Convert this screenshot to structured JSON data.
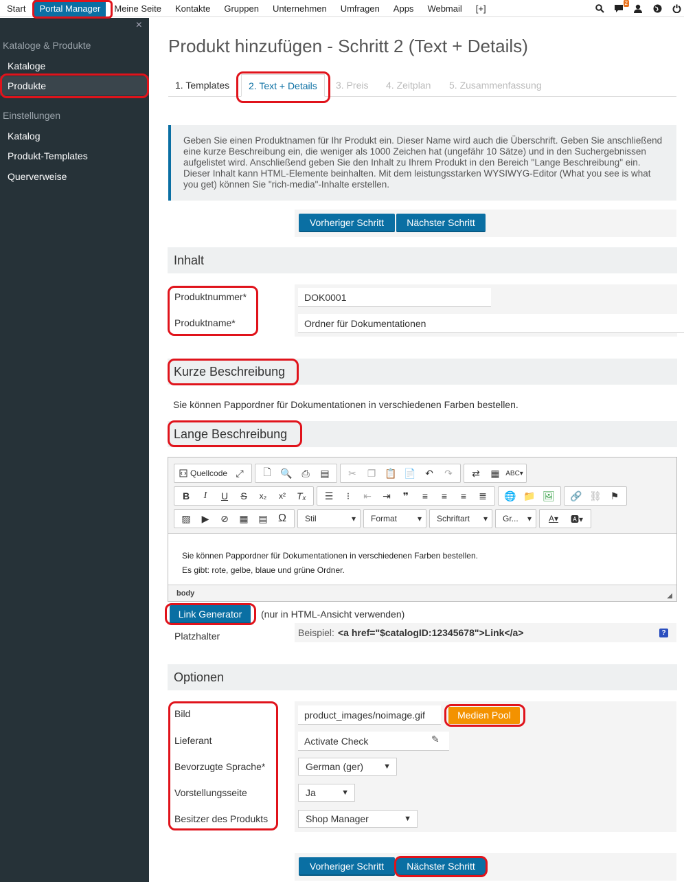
{
  "topnav": {
    "items": [
      "Start",
      "Portal Manager",
      "Meine Seite",
      "Kontakte",
      "Gruppen",
      "Unternehmen",
      "Umfragen",
      "Apps",
      "Webmail",
      "[+]"
    ],
    "notification_count": "2"
  },
  "sidebar": {
    "close": "×",
    "section1": "Kataloge & Produkte",
    "link_kataloge": "Kataloge",
    "link_produkte": "Produkte",
    "section2": "Einstellungen",
    "link_katalog": "Katalog",
    "link_templates": "Produkt-Templates",
    "link_querverweise": "Querverweise"
  },
  "page": {
    "title": "Produkt hinzufügen - Schritt 2 (Text + Details)",
    "tabs": [
      "1. Templates",
      "2. Text + Details",
      "3. Preis",
      "4. Zeitplan",
      "5. Zusammenfassung"
    ],
    "info": "Geben Sie einen Produktnamen für Ihr Produkt ein. Dieser Name wird auch die Überschrift. Geben Sie anschließend eine kurze Beschreibung ein, die weniger als 1000 Zeichen hat (ungefähr 10 Sätze) und in den Suchergebnissen aufgelistet wird. Anschließend geben Sie den Inhalt zu Ihrem Produkt in den Bereich \"Lange Beschreibung\" ein. Dieser Inhalt kann HTML-Elemente beinhalten. Mit dem leistungsstarken WYSIWYG-Editor (What you see is what you get) können Sie \"rich-media\"-Inhalte erstellen.",
    "btn_prev": "Vorheriger Schritt",
    "btn_next": "Nächster Schritt"
  },
  "inhalt": {
    "heading": "Inhalt",
    "label_nummer": "Produktnummer*",
    "value_nummer": "DOK0001",
    "label_name": "Produktname*",
    "value_name": "Ordner für Dokumentationen"
  },
  "kurz": {
    "heading": "Kurze Beschreibung",
    "text": "Sie können Pappordner für Dokumentationen in verschiedenen Farben bestellen."
  },
  "lang": {
    "heading": "Lange Beschreibung",
    "toolbar": {
      "source": "Quellcode",
      "style": "Stil",
      "format": "Format",
      "font": "Schriftart",
      "size": "Gr..."
    },
    "line1": "Sie können Pappordner für Dokumentationen in verschiedenen Farben bestellen.",
    "line2": "Es gibt: rote, gelbe, blaue und grüne Ordner.",
    "path": "body"
  },
  "link": {
    "button": "Link Generator",
    "note": "(nur in HTML-Ansicht verwenden)",
    "label": "Platzhalter",
    "example_prefix": "Beispiel:",
    "example_code": "<a href=\"$catalogID:12345678\">Link</a>",
    "help": "?"
  },
  "optionen": {
    "heading": "Optionen",
    "label_bild": "Bild",
    "value_bild": "product_images/noimage.gif",
    "medien_pool": "Medien Pool",
    "label_lieferant": "Lieferant",
    "value_lieferant": "Activate Check",
    "label_sprache": "Bevorzugte Sprache*",
    "value_sprache": "German (ger)",
    "label_vorstellung": "Vorstellungsseite",
    "value_vorstellung": "Ja",
    "label_besitzer": "Besitzer des Produkts",
    "value_besitzer": "Shop Manager"
  },
  "colors": {
    "accent": "#0a6fa3",
    "highlight": "#e0131b",
    "orange": "#f39200",
    "sidebar": "#263238"
  }
}
